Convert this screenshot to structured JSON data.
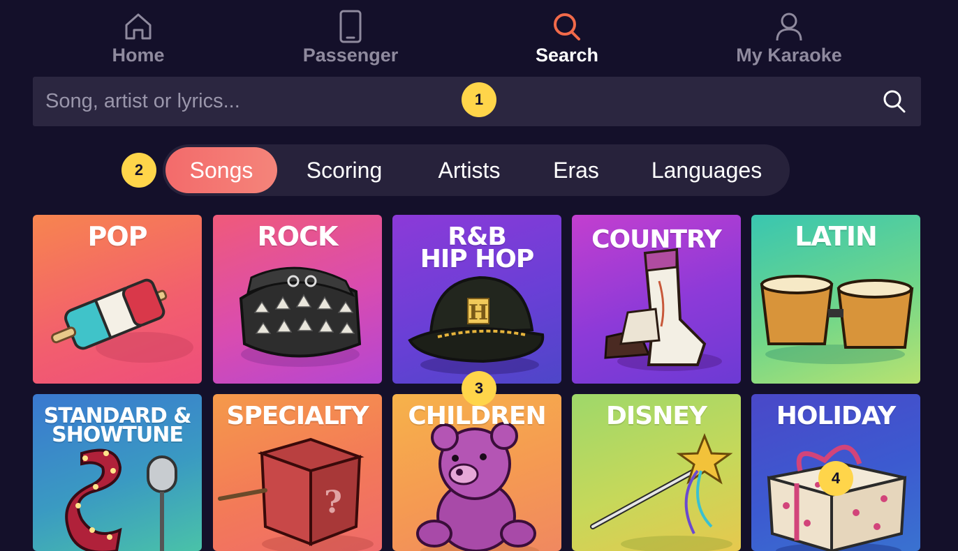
{
  "nav": {
    "items": [
      {
        "label": "Home",
        "icon": "home-icon"
      },
      {
        "label": "Passenger",
        "icon": "phone-icon"
      },
      {
        "label": "Search",
        "icon": "search-icon"
      },
      {
        "label": "My Karaoke",
        "icon": "user-icon"
      }
    ],
    "active": "Search",
    "active_color": "#f26a4a"
  },
  "search": {
    "placeholder": "Song, artist or lyrics...",
    "value": ""
  },
  "tabs": {
    "items": [
      "Songs",
      "Scoring",
      "Artists",
      "Eras",
      "Languages"
    ],
    "active": "Songs"
  },
  "badges": [
    "1",
    "2",
    "3",
    "4"
  ],
  "genres": [
    {
      "title": "POP",
      "art": "popsicle"
    },
    {
      "title": "ROCK",
      "art": "spiked-bracelet"
    },
    {
      "title": "R&B\nHIP HOP",
      "art": "cap"
    },
    {
      "title": "COUNTRY",
      "art": "cowboy-boots"
    },
    {
      "title": "LATIN",
      "art": "bongos"
    },
    {
      "title": "STANDARD &\nSHOWTUNE",
      "art": "marquee-s-microphone"
    },
    {
      "title": "SPECIALTY",
      "art": "mystery-box"
    },
    {
      "title": "CHILDREN",
      "art": "teddy-bear"
    },
    {
      "title": "DISNEY",
      "art": "magic-wand"
    },
    {
      "title": "HOLIDAY",
      "art": "gift-box"
    }
  ]
}
